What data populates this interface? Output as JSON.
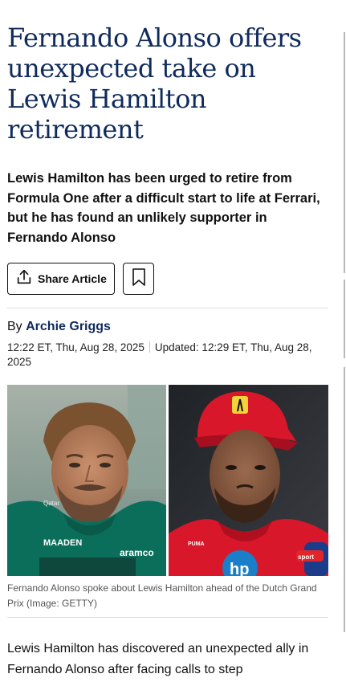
{
  "article": {
    "headline": "Fernando Alonso offers unexpected take on Lewis Hamilton retirement",
    "standfirst": "Lewis Hamilton has been urged to retire from Formula One after a difficult start to life at Ferrari, but he has found an unlikely supporter in Fernando Alonso",
    "share_label": "Share Article",
    "share_icon": "share-upload-icon",
    "bookmark_icon": "bookmark-icon",
    "byline_prefix": "By",
    "author": "Archie Griggs",
    "published": "12:22 ET, Thu, Aug 28, 2025",
    "updated": "Updated: 12:29 ET, Thu, Aug 28, 2025",
    "image_caption": "Fernando Alonso spoke about Lewis Hamilton ahead of the Dutch Grand Prix (Image: GETTY)",
    "image_text": {
      "sponsor_left": "Qatar",
      "maaden": "MAADEN",
      "aramco": "aramco",
      "hp": "hp",
      "puma": "PUMA",
      "sport": "sport"
    },
    "body": "Lewis Hamilton has discovered an unexpected ally in Fernando Alonso after facing calls to step"
  },
  "colors": {
    "headline": "#0f2a5c",
    "author": "#0f2a5c",
    "aston_green": "#0b6e5a",
    "ferrari_red": "#d8172a"
  }
}
